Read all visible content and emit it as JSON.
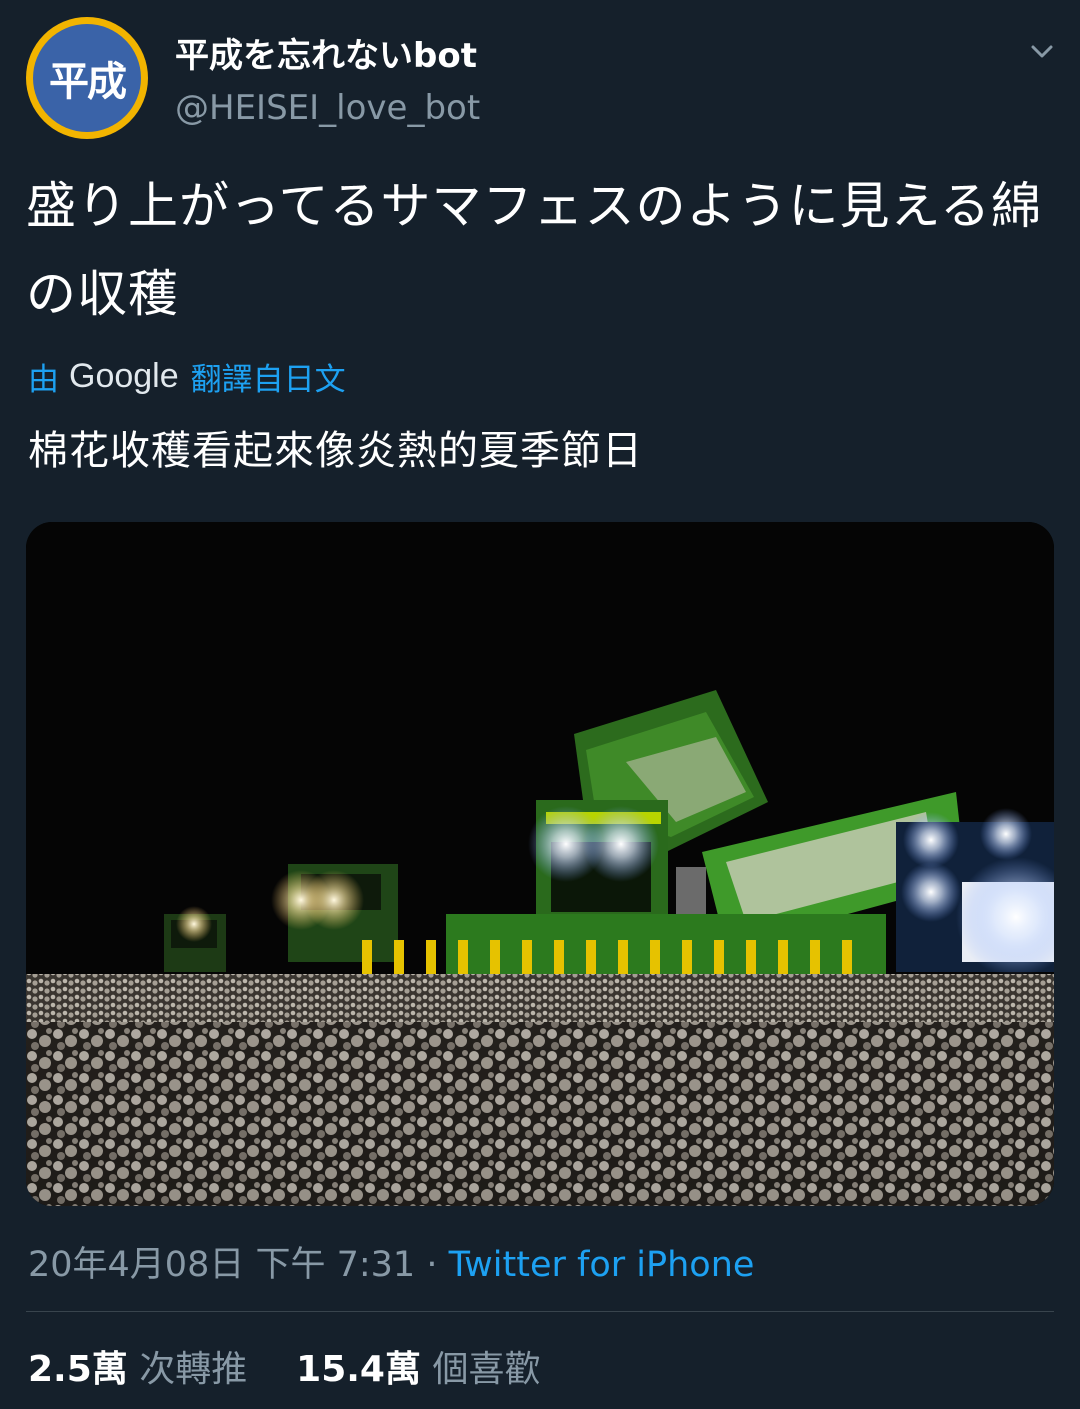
{
  "user": {
    "avatar_text": "平成",
    "display_name": "平成を忘れないbot",
    "handle": "@HEISEI_love_bot"
  },
  "tweet": {
    "text": "盛り上がってるサマフェスのように見える綿の収穫",
    "translation_prefix": "由",
    "translation_brand": "Google",
    "translation_suffix": "翻譯自日文",
    "translated_text": "棉花收穫看起來像炎熱的夏季節日"
  },
  "meta": {
    "timestamp": "20年4月08日 下午 7:31",
    "separator": " · ",
    "source": "Twitter for iPhone"
  },
  "stats": {
    "retweets_count": "2.5萬",
    "retweets_label": "次轉推",
    "likes_count": "15.4萬",
    "likes_label": "個喜歡"
  },
  "colors": {
    "background": "#15202b",
    "accent": "#1da1f2",
    "secondary_text": "#8899a6",
    "divider": "#38444d"
  },
  "icons": {
    "menu": "chevron-down-icon"
  }
}
